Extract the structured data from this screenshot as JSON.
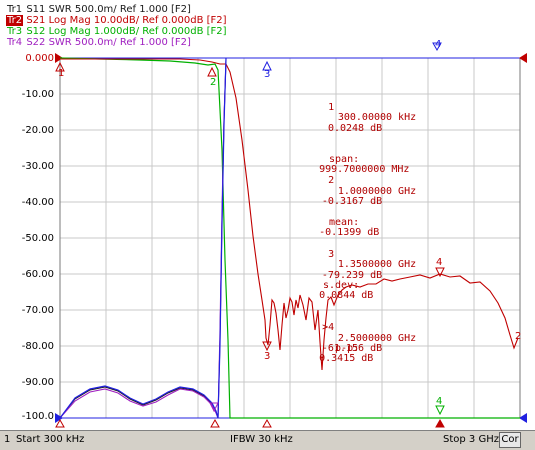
{
  "traces": [
    {
      "tag": "Tr1",
      "desc": "S11 SWR 500.0m/ Ref 1.000 [F2]",
      "color": "#1a1a1a",
      "active": false
    },
    {
      "tag": "Tr2",
      "desc": "S21 Log Mag 10.00dB/ Ref 0.000dB [F2]",
      "color": "#c00000",
      "active": true
    },
    {
      "tag": "Tr3",
      "desc": "S12 Log Mag 1.000dB/ Ref 0.000dB [F2]",
      "color": "#00b000",
      "active": false
    },
    {
      "tag": "Tr4",
      "desc": "S22 SWR 500.0m/ Ref 1.000 [F2]",
      "color": "#a020c0",
      "active": false
    }
  ],
  "y_axis_labels": [
    "0.000",
    "-10.00",
    "-20.00",
    "-30.00",
    "-40.00",
    "-50.00",
    "-60.00",
    "-70.00",
    "-80.00",
    "-90.00",
    "-100.0"
  ],
  "markers": {
    "rows": [
      {
        "id": "1",
        "freq": "300.00000 kHz",
        "value": "0.0248 dB"
      },
      {
        "id": "2",
        "freq": "1.0000000 GHz",
        "value": "-0.3167 dB"
      },
      {
        "id": "3",
        "freq": "1.3500000 GHz",
        "value": "-79.239 dB"
      },
      {
        "id": ">4",
        "freq": "2.5000000 GHz",
        "value": "-61.156 dB"
      }
    ],
    "stats": [
      {
        "label": "span:",
        "value": "999.7000000 MHz"
      },
      {
        "label": "mean:",
        "value": "-0.1399 dB"
      },
      {
        "label": "s.dev:",
        "value": "0.0844 dB"
      },
      {
        "label": "p-p:",
        "value": "0.3415 dB"
      }
    ],
    "labels": {
      "m1": "1",
      "m2": "2",
      "m3": "3",
      "m4": "4"
    }
  },
  "status_bar": {
    "channel": "1",
    "start": "Start 300 kHz",
    "ifbw": "IFBW 30 kHz",
    "stop": "Stop 3 GHz",
    "cor": "Cor"
  },
  "colors": {
    "grid": "#c8c8c8",
    "tr1": "#1a1a1a",
    "tr2": "#c00000",
    "tr3": "#00b000",
    "tr4": "#a020c0",
    "blue": "#2020e0"
  }
}
